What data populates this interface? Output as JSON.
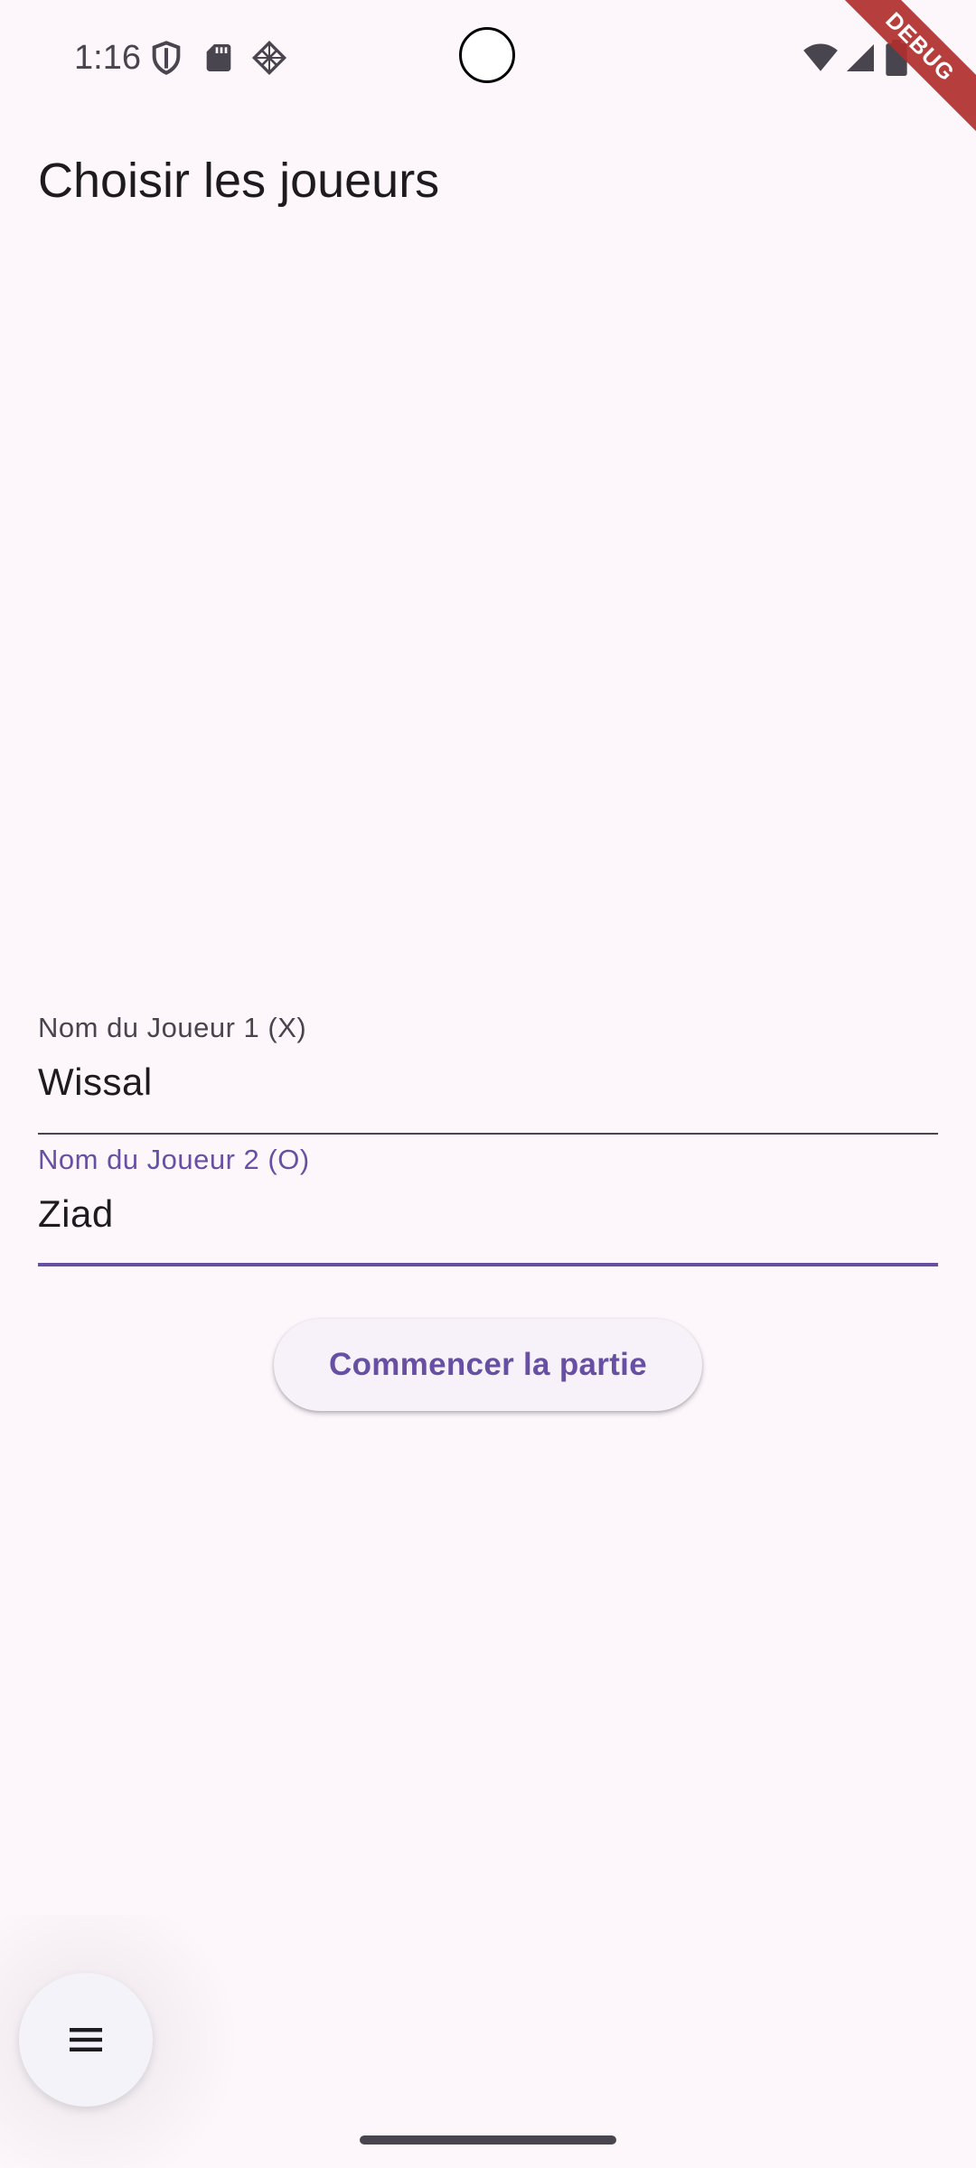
{
  "status_bar": {
    "time": "1:16",
    "icons": [
      "shield-icon",
      "sd-card-icon",
      "diamond-pattern-icon",
      "wifi-icon",
      "signal-icon",
      "battery-icon"
    ]
  },
  "debug_banner": "DEBUG",
  "app_bar": {
    "title": "Choisir les joueurs"
  },
  "form": {
    "player1": {
      "label": "Nom du Joueur 1 (X)",
      "value": "Wissal"
    },
    "player2": {
      "label": "Nom du Joueur 2 (O)",
      "value": "Ziad"
    },
    "start_button_label": "Commencer la partie"
  },
  "fab": {
    "icon": "menu-icon"
  },
  "colors": {
    "background": "#FDF7FC",
    "primary": "#6750A4",
    "on_surface": "#1D1B20",
    "on_surface_variant": "#49454F",
    "debug_ribbon": "#B0302E"
  }
}
